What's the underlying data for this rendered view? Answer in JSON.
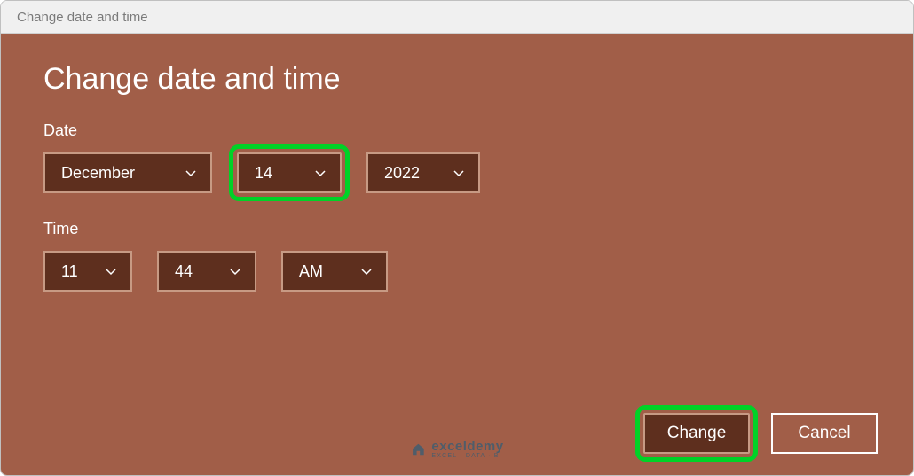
{
  "window": {
    "title": "Change date and time"
  },
  "heading": "Change date and time",
  "sections": {
    "date_label": "Date",
    "time_label": "Time"
  },
  "date": {
    "month": "December",
    "day": "14",
    "year": "2022"
  },
  "time": {
    "hour": "11",
    "minute": "44",
    "ampm": "AM"
  },
  "buttons": {
    "change": "Change",
    "cancel": "Cancel"
  },
  "watermark": {
    "main": "exceldemy",
    "sub": "EXCEL · DATA · BI"
  }
}
